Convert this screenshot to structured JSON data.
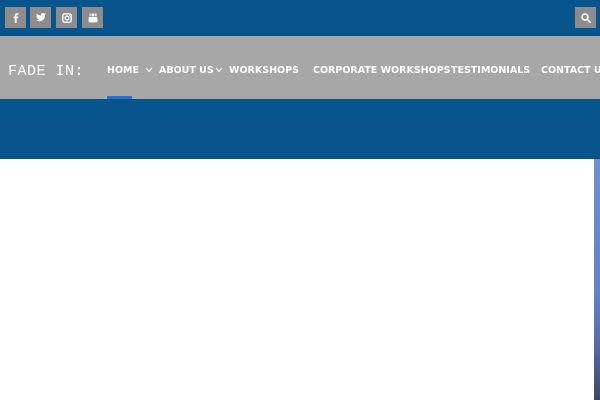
{
  "social": [
    {
      "icon": "facebook-icon"
    },
    {
      "icon": "twitter-icon"
    },
    {
      "icon": "instagram-icon"
    },
    {
      "icon": "youtube-icon"
    }
  ],
  "header": {
    "logo_text": "FADE IN:",
    "search_icon": "search-icon"
  },
  "nav": {
    "items": [
      {
        "label": "HOME",
        "active": true
      },
      {
        "label": "ABOUT US",
        "has_dropdown": true
      },
      {
        "label": "WORKSHOPS",
        "has_dropdown": true
      },
      {
        "label": "CORPORATE WORKSHOPS"
      },
      {
        "label": "TESTIMONIALS"
      },
      {
        "label": "CONTACT US"
      }
    ]
  },
  "colors": {
    "topbar": "#07558c",
    "navbar": "#a7a7a7",
    "active_indicator": "#2b6fce",
    "icon_button": "#8c8c8c"
  }
}
